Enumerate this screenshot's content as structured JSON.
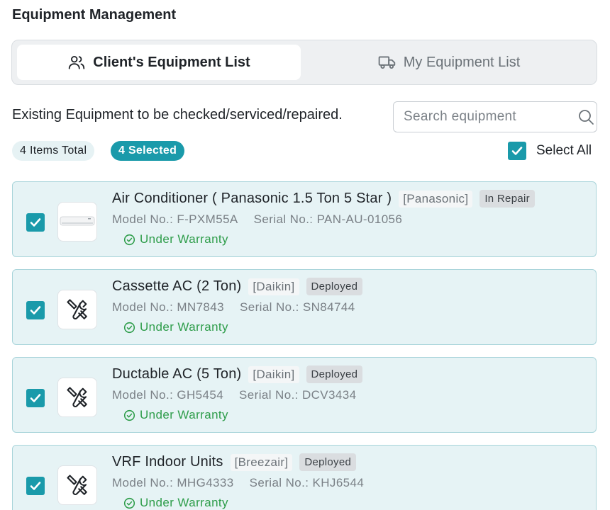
{
  "page": {
    "title": "Equipment Management"
  },
  "tabs": [
    {
      "label": "Client's Equipment List",
      "icon": "users-icon",
      "active": true
    },
    {
      "label": "My Equipment List",
      "icon": "truck-icon",
      "active": false
    }
  ],
  "section": {
    "description": "Existing Equipment to be checked/serviced/repaired."
  },
  "search": {
    "placeholder": "Search equipment",
    "value": ""
  },
  "summary": {
    "total": "4 Items Total",
    "selected": "4 Selected"
  },
  "select_all": {
    "label": "Select All",
    "checked": true
  },
  "labels": {
    "model": "Model No.:",
    "serial": "Serial No.:"
  },
  "colors": {
    "accent": "#1a9aaa",
    "card_bg": "#e6f3f5",
    "card_border": "#a8d4da",
    "warranty": "#2e9d4a"
  },
  "items": [
    {
      "name": "Air Conditioner ( Panasonic 1.5 Ton 5 Star )",
      "brand": "[Panasonic]",
      "status": "In Repair",
      "model": "F-PXM55A",
      "serial": "PAN-AU-01056",
      "warranty": "Under Warranty",
      "thumbnail": "ac-unit-image",
      "checked": true
    },
    {
      "name": "Cassette AC (2 Ton)",
      "brand": "[Daikin]",
      "status": "Deployed",
      "model": "MN7843",
      "serial": "SN84744",
      "warranty": "Under Warranty",
      "thumbnail": "tools-icon",
      "checked": true
    },
    {
      "name": "Ductable AC (5 Ton)",
      "brand": "[Daikin]",
      "status": "Deployed",
      "model": "GH5454",
      "serial": "DCV3434",
      "warranty": "Under Warranty",
      "thumbnail": "tools-icon",
      "checked": true
    },
    {
      "name": "VRF Indoor Units",
      "brand": "[Breezair]",
      "status": "Deployed",
      "model": "MHG4333",
      "serial": "KHJ6544",
      "warranty": "Under Warranty",
      "thumbnail": "tools-icon",
      "checked": true
    }
  ]
}
